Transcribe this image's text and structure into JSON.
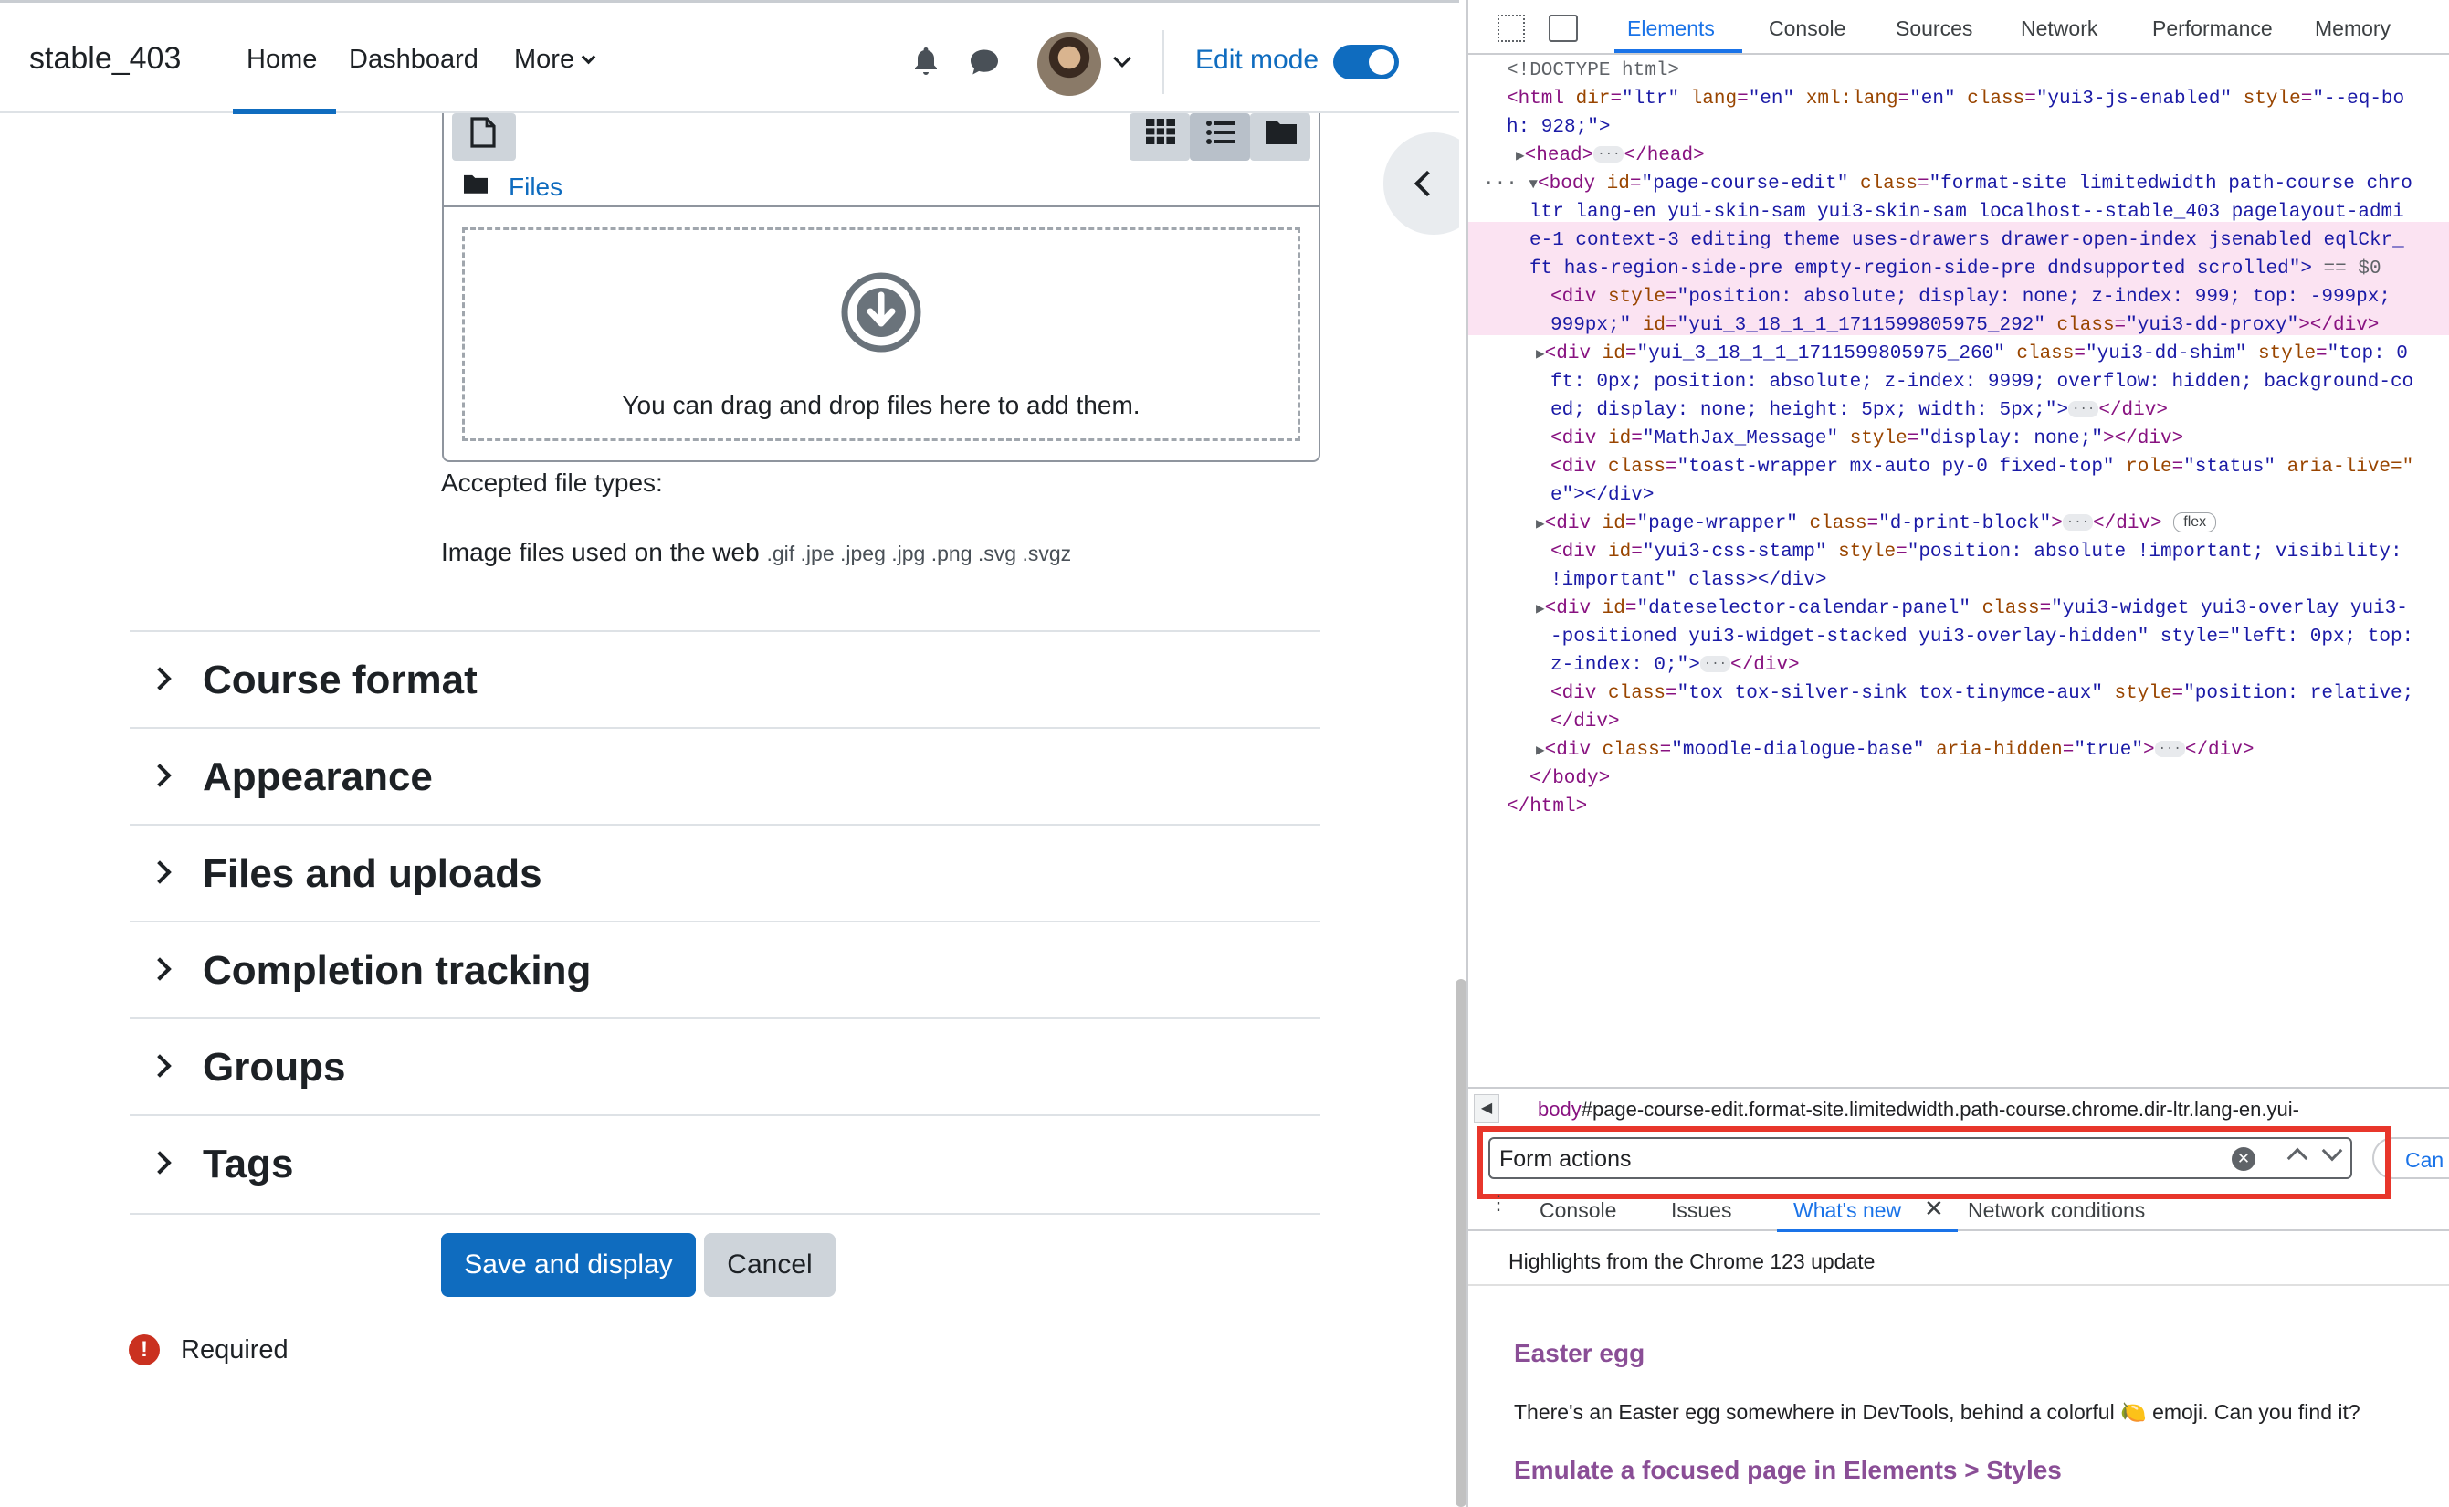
{
  "moodle": {
    "brand": "stable_403",
    "nav": {
      "home": "Home",
      "dashboard": "Dashboard",
      "more": "More"
    },
    "edit_mode_label": "Edit mode",
    "edit_mode_on": true,
    "filepicker": {
      "files_link": "Files",
      "drop_text": "You can drag and drop files here to add them."
    },
    "accepted_label": "Accepted file types:",
    "accepted_types_main": "Image files used on the web",
    "accepted_types_ext": ".gif .jpe .jpeg .jpg .png .svg .svgz",
    "sections": [
      {
        "title": "Course format"
      },
      {
        "title": "Appearance"
      },
      {
        "title": "Files and uploads"
      },
      {
        "title": "Completion tracking"
      },
      {
        "title": "Groups"
      },
      {
        "title": "Tags"
      }
    ],
    "save_label": "Save and display",
    "cancel_label": "Cancel",
    "required_label": "Required",
    "colors": {
      "primary": "#0f6cbf",
      "danger": "#ca3120",
      "secondary": "#ced4da"
    }
  },
  "devtools": {
    "tabs": [
      "Elements",
      "Console",
      "Sources",
      "Network",
      "Performance",
      "Memory"
    ],
    "active_tab": "Elements",
    "dom": {
      "l1": "<!DOCTYPE html>",
      "l2a": "<html ",
      "l2b": "dir",
      "l2c": "\"ltr\"",
      "l2d": "lang",
      "l2e": "\"en\"",
      "l2f": "xml:lang",
      "l2g": "\"en\"",
      "l2h": "class",
      "l2i": "\"yui3-js-enabled\"",
      "l2j": "style",
      "l2k": "\"--eq-bo",
      "l3": "h: 928;\">",
      "l4a": "<head>",
      "l4b": "</head>",
      "l5a": "<body ",
      "l5b": "id",
      "l5c": "\"page-course-edit\"",
      "l5d": "class",
      "l5e": "\"format-site limitedwidth path-course chro",
      "l6": "ltr lang-en yui-skin-sam yui3-skin-sam localhost--stable_403 pagelayout-admi",
      "l7": "e-1 context-3 editing theme uses-drawers drawer-open-index jsenabled eqlCkr_",
      "l8": "ft has-region-side-pre empty-region-side-pre dndsupported scrolled\">",
      "l8b": " == $0",
      "l9a": "<div ",
      "l9b": "style",
      "l9c": "\"position: absolute; display: none; z-index: 999; top: -999px; ",
      "l10a": "999px;\" ",
      "l10b": "id",
      "l10c": "\"yui_3_18_1_1_1711599805975_292\"",
      "l10d": "class",
      "l10e": "\"yui3-dd-proxy\"",
      "l10f": "></div>",
      "l11a": "<div ",
      "l11b": "id",
      "l11c": "\"yui_3_18_1_1_1711599805975_260\"",
      "l11d": "class",
      "l11e": "\"yui3-dd-shim\"",
      "l11f": "style",
      "l11g": "\"top: 0",
      "l12": "ft: 0px; position: absolute; z-index: 9999; overflow: hidden; background-co",
      "l13a": "ed; display: none; height: 5px; width: 5px;\">",
      "l13b": "</div>",
      "l14a": "<div ",
      "l14b": "id",
      "l14c": "\"MathJax_Message\"",
      "l14d": "style",
      "l14e": "\"display: none;\"",
      "l14f": "></div>",
      "l15a": "<div ",
      "l15b": "class",
      "l15c": "\"toast-wrapper mx-auto py-0 fixed-top\"",
      "l15d": "role",
      "l15e": "\"status\"",
      "l15f": "aria-live=\"",
      "l16": "e\"></div>",
      "l17a": "<div ",
      "l17b": "id",
      "l17c": "\"page-wrapper\"",
      "l17d": "class",
      "l17e": "\"d-print-block\"",
      "l17f": ">",
      "l17g": "</div>",
      "l17badge": "flex",
      "l18a": "<div ",
      "l18b": "id",
      "l18c": "\"yui3-css-stamp\"",
      "l18d": "style",
      "l18e": "\"position: absolute !important; visibility: ",
      "l19": "!important\" class></div>",
      "l20a": "<div ",
      "l20b": "id",
      "l20c": "\"dateselector-calendar-panel\"",
      "l20d": "class",
      "l20e": "\"yui3-widget yui3-overlay yui3-",
      "l21": "-positioned yui3-widget-stacked yui3-overlay-hidden\" style=\"left: 0px; top:",
      "l22a": "z-index: 0;\">",
      "l22b": "</div>",
      "l23a": "<div ",
      "l23b": "class",
      "l23c": "\"tox tox-silver-sink tox-tinymce-aux\"",
      "l23d": "style",
      "l23e": "\"position: relative;",
      "l24": "</div>",
      "l25a": "<div ",
      "l25b": "class",
      "l25c": "\"moodle-dialogue-base\"",
      "l25d": "aria-hidden",
      "l25e": "\"true\"",
      "l25f": ">",
      "l25g": "</div>",
      "l26": "</body>",
      "l27": "</html>"
    },
    "breadcrumb_tag": "body",
    "breadcrumb_rest": "#page-course-edit.format-site.limitedwidth.path-course.chrome.dir-ltr.lang-en.yui-",
    "search_value": "Form actions",
    "search_cancel": "Can",
    "drawer_tabs": [
      "Console",
      "Issues",
      "What's new",
      "Network conditions"
    ],
    "drawer_active": "What's new",
    "whatsnew_heading": "Highlights from the Chrome 123 update",
    "whatsnew_items": [
      {
        "title": "Easter egg",
        "text": "There's an Easter egg somewhere in DevTools, behind a colorful 🍋 emoji. Can you find it?"
      },
      {
        "title": "Emulate a focused page in Elements > Styles"
      }
    ],
    "colors": {
      "accent": "#1a73e8",
      "tag": "#881280",
      "attr": "#994500",
      "value": "#1a1aa6",
      "highlight": "#e8362b"
    }
  }
}
